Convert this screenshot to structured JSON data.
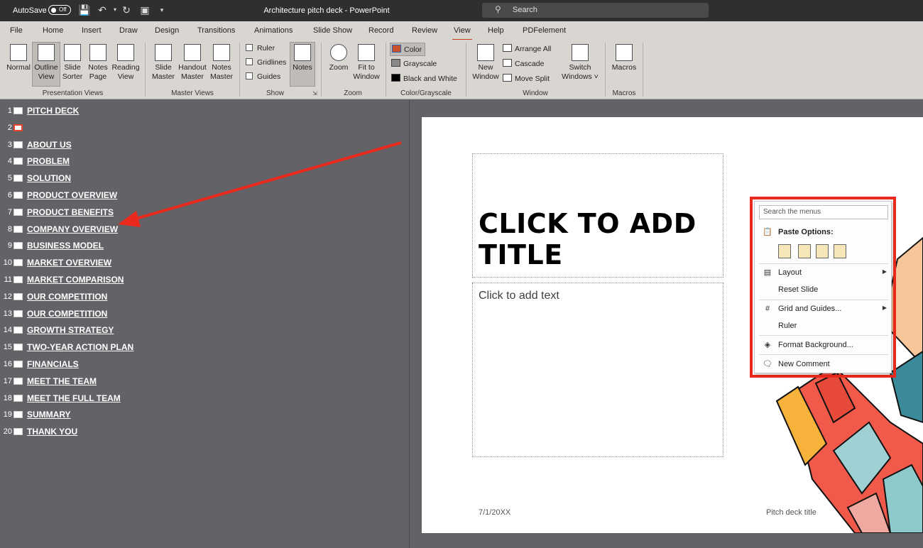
{
  "titlebar": {
    "autosave_label": "AutoSave",
    "autosave_state": "Off",
    "document_title": "Architecture pitch deck  -  PowerPoint",
    "search_label": "Search"
  },
  "tabs": [
    {
      "label": "File"
    },
    {
      "label": "Home"
    },
    {
      "label": "Insert"
    },
    {
      "label": "Draw"
    },
    {
      "label": "Design"
    },
    {
      "label": "Transitions"
    },
    {
      "label": "Animations"
    },
    {
      "label": "Slide Show"
    },
    {
      "label": "Record"
    },
    {
      "label": "Review"
    },
    {
      "label": "View",
      "active": true
    },
    {
      "label": "Help"
    },
    {
      "label": "PDFelement"
    }
  ],
  "ribbon": {
    "presentation_views": {
      "group": "Presentation Views",
      "normal": "Normal",
      "outline_1": "Outline",
      "outline_2": "View",
      "sorter_1": "Slide",
      "sorter_2": "Sorter",
      "notes_page_1": "Notes",
      "notes_page_2": "Page",
      "reading_1": "Reading",
      "reading_2": "View"
    },
    "master_views": {
      "group": "Master Views",
      "slide_master_1": "Slide",
      "slide_master_2": "Master",
      "handout_master_1": "Handout",
      "handout_master_2": "Master",
      "notes_master_1": "Notes",
      "notes_master_2": "Master"
    },
    "show": {
      "group": "Show",
      "ruler": "Ruler",
      "gridlines": "Gridlines",
      "guides": "Guides",
      "notes": "Notes"
    },
    "zoom": {
      "group": "Zoom",
      "zoom": "Zoom",
      "fit_1": "Fit to",
      "fit_2": "Window"
    },
    "color": {
      "group": "Color/Grayscale",
      "color": "Color",
      "grayscale": "Grayscale",
      "bw": "Black and White"
    },
    "window": {
      "group": "Window",
      "new_1": "New",
      "new_2": "Window",
      "arrange": "Arrange All",
      "cascade": "Cascade",
      "move_split": "Move Split",
      "switch_1": "Switch",
      "switch_2": "Windows ˅"
    },
    "macros": {
      "group": "Macros",
      "macros": "Macros"
    }
  },
  "outline": [
    {
      "num": "1",
      "text": "PITCH DECK"
    },
    {
      "num": "2",
      "text": "",
      "selected": true
    },
    {
      "num": "3",
      "text": "ABOUT US"
    },
    {
      "num": "4",
      "text": "PROBLEM"
    },
    {
      "num": "5",
      "text": "SOLUTION"
    },
    {
      "num": "6",
      "text": "PRODUCT OVERVIEW"
    },
    {
      "num": "7",
      "text": "PRODUCT BENEFITS"
    },
    {
      "num": "8",
      "text": "COMPANY OVERVIEW"
    },
    {
      "num": "9",
      "text": "BUSINESS MODEL"
    },
    {
      "num": "10",
      "text": "MARKET OVERVIEW"
    },
    {
      "num": "11",
      "text": "MARKET COMPARISON"
    },
    {
      "num": "12",
      "text": "OUR COMPETITION"
    },
    {
      "num": "13",
      "text": "OUR COMPETITION"
    },
    {
      "num": "14",
      "text": "GROWTH STRATEGY"
    },
    {
      "num": "15",
      "text": "TWO-YEAR ACTION PLAN"
    },
    {
      "num": "16",
      "text": "FINANCIALS"
    },
    {
      "num": "17",
      "text": "MEET THE TEAM"
    },
    {
      "num": "18",
      "text": "MEET THE FULL TEAM"
    },
    {
      "num": "19",
      "text": "SUMMARY"
    },
    {
      "num": "20",
      "text": "THANK YOU"
    }
  ],
  "slide": {
    "title_placeholder": "CLICK TO ADD TITLE",
    "body_placeholder": "Click to add text",
    "footer_date": "7/1/20XX",
    "footer_title": "Pitch deck title"
  },
  "context_menu": {
    "search_placeholder": "Search the menus",
    "paste_options": "Paste Options:",
    "layout": "Layout",
    "reset_slide": "Reset Slide",
    "grid_guides": "Grid and Guides...",
    "ruler": "Ruler",
    "format_background": "Format Background...",
    "new_comment": "New Comment"
  },
  "colors": {
    "annotation_red": "#e8291b",
    "active_tab_underline": "#c43e1c",
    "pane_background": "#636266"
  }
}
